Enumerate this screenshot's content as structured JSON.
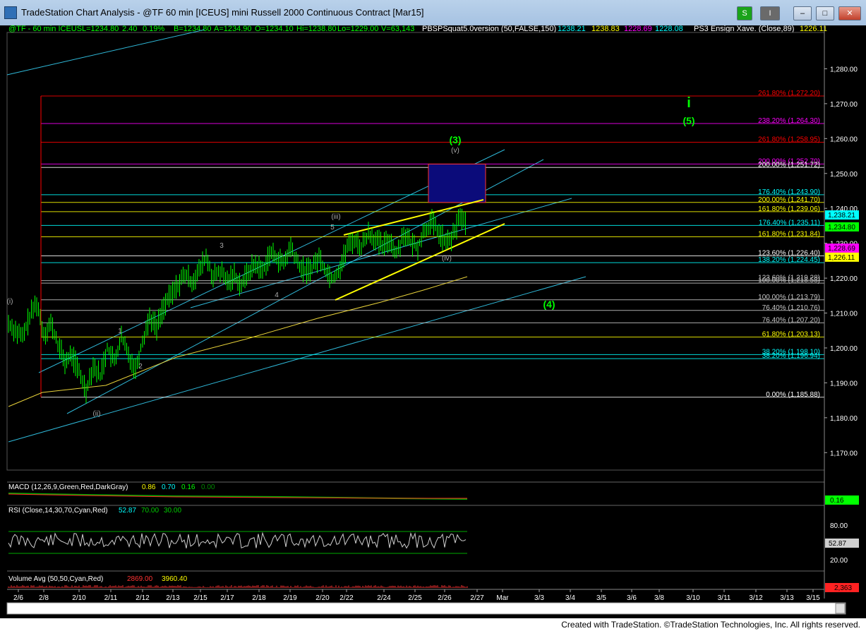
{
  "window": {
    "title": "TradeStation Chart Analysis - @TF 60 min [ICEUS] mini Russell 2000 Continuous Contract [Mar15]",
    "btn_s": "S",
    "btn_i": "I"
  },
  "header": {
    "symbol": "@TF - 60 min  ICEUS",
    "last": "L=1234.80",
    "change": "2.40",
    "pct": "0.19%",
    "bid": "B=1234.80",
    "ask": "A=1234.90",
    "open": "O=1234.10",
    "high": "Hi=1238.80",
    "low": "Lo=1229.00",
    "vol": "V=63,143",
    "indicator": "PBSPSquat5.0version (50,FALSE,150)",
    "ind_v1": "1238.21",
    "ind_v2": "1238.83",
    "ind_v3": "1228.69",
    "ind_v4": "1228.08",
    "ps3": "PS3 Ensign Xave. (Close,89)",
    "ps3_val": "1226.11"
  },
  "colors": {
    "price": "#00ff00",
    "cyan": "#00ffff",
    "yellow": "#ffff00",
    "red": "#ff0000",
    "magenta": "#ff00ff",
    "blue_box": "#0b0b7a",
    "fib_gray": "#c8c8c8"
  },
  "chart_data": [
    {
      "type": "line",
      "panel": "price",
      "y_axis": {
        "ylim": [
          1165,
          1290
        ],
        "ticks": [
          1170,
          1180,
          1190,
          1200,
          1210,
          1220,
          1230,
          1240,
          1250,
          1260,
          1270,
          1280
        ],
        "tick_labels": [
          "1,170.00",
          "1,180.00",
          "1,190.00",
          "1,200.00",
          "1,210.00",
          "1,220.00",
          "1,230.00",
          "1,240.00",
          "1,250.00",
          "1,260.00",
          "1,270.00",
          "1,280.00"
        ]
      },
      "x_axis": {
        "tick_labels": [
          "2/6",
          "2/8",
          "2/10",
          "2/11",
          "2/12",
          "2/13",
          "2/15",
          "2/17",
          "2/18",
          "2/19",
          "2/20",
          "2/22",
          "2/24",
          "2/25",
          "2/26",
          "2/27",
          "Mar",
          "3/3",
          "3/4",
          "3/5",
          "3/6",
          "3/8",
          "3/10",
          "3/11",
          "3/12",
          "3/13",
          "3/15"
        ]
      },
      "price_points": [
        [
          0,
          1207
        ],
        [
          4,
          1205
        ],
        [
          8,
          1203
        ],
        [
          12,
          1209
        ],
        [
          16,
          1213
        ],
        [
          20,
          1204
        ],
        [
          24,
          1207
        ],
        [
          28,
          1201
        ],
        [
          32,
          1196
        ],
        [
          36,
          1198
        ],
        [
          40,
          1193
        ],
        [
          44,
          1188
        ],
        [
          48,
          1195
        ],
        [
          52,
          1192
        ],
        [
          56,
          1200
        ],
        [
          60,
          1196
        ],
        [
          64,
          1203
        ],
        [
          68,
          1198
        ],
        [
          72,
          1194
        ],
        [
          76,
          1202
        ],
        [
          80,
          1209
        ],
        [
          84,
          1206
        ],
        [
          88,
          1212
        ],
        [
          92,
          1215
        ],
        [
          96,
          1218
        ],
        [
          100,
          1221
        ],
        [
          104,
          1219
        ],
        [
          108,
          1222
        ],
        [
          112,
          1226
        ],
        [
          116,
          1220
        ],
        [
          120,
          1222
        ],
        [
          124,
          1219
        ],
        [
          128,
          1221
        ],
        [
          132,
          1218
        ],
        [
          136,
          1222
        ],
        [
          140,
          1224
        ],
        [
          144,
          1222
        ],
        [
          148,
          1227
        ],
        [
          152,
          1226
        ],
        [
          156,
          1224
        ],
        [
          160,
          1229
        ],
        [
          164,
          1224
        ],
        [
          168,
          1222
        ],
        [
          172,
          1223
        ],
        [
          176,
          1226
        ],
        [
          180,
          1222
        ],
        [
          184,
          1220
        ],
        [
          188,
          1223
        ],
        [
          192,
          1229
        ],
        [
          196,
          1231
        ],
        [
          200,
          1229
        ],
        [
          204,
          1233
        ],
        [
          208,
          1231
        ],
        [
          212,
          1229
        ],
        [
          216,
          1231
        ],
        [
          220,
          1227
        ],
        [
          224,
          1233
        ],
        [
          228,
          1230
        ],
        [
          232,
          1229
        ],
        [
          236,
          1234
        ],
        [
          240,
          1236
        ],
        [
          244,
          1233
        ],
        [
          248,
          1230
        ],
        [
          252,
          1232
        ],
        [
          256,
          1238
        ],
        [
          260,
          1234.8
        ]
      ],
      "levels": [
        {
          "label": "261.80% (1,272.20)",
          "value": 1272.2,
          "color": "#ff0000"
        },
        {
          "label": "238.20% (1,264.30)",
          "value": 1264.3,
          "color": "#ff00ff"
        },
        {
          "label": "261.80% (1,258.95)",
          "value": 1258.95,
          "color": "#ff0000"
        },
        {
          "label": "200.00% (1,252.70)",
          "value": 1252.7,
          "color": "#ff00ff"
        },
        {
          "label": "200.00% (1,251.72)",
          "value": 1251.72,
          "color": "#ffffff"
        },
        {
          "label": "176.40% (1,243.90)",
          "value": 1243.9,
          "color": "#00ffff"
        },
        {
          "label": "200.00% (1,241.70)",
          "value": 1241.7,
          "color": "#ffff00"
        },
        {
          "label": "161.80% (1,239.06)",
          "value": 1239.06,
          "color": "#ffff00"
        },
        {
          "label": "176.40% (1,235.11)",
          "value": 1235.11,
          "color": "#00ffff"
        },
        {
          "label": "161.80% (1,231.84)",
          "value": 1231.84,
          "color": "#ffff00"
        },
        {
          "label": "123.60% (1,226.40)",
          "value": 1226.4,
          "color": "#ffffff"
        },
        {
          "label": "138.20% (1,224.45)",
          "value": 1224.45,
          "color": "#00ffff"
        },
        {
          "label": "123.60% (1,219.28)",
          "value": 1219.28,
          "color": "#c8c8c8"
        },
        {
          "label": "100.00% (1,218.58)",
          "value": 1218.58,
          "color": "#c8c8c8"
        },
        {
          "label": "100.00% (1,213.79)",
          "value": 1213.79,
          "color": "#c8c8c8"
        },
        {
          "label": "76.40% (1,210.76)",
          "value": 1210.76,
          "color": "#c8c8c8"
        },
        {
          "label": "76.40% (1,207.20)",
          "value": 1207.2,
          "color": "#c8c8c8"
        },
        {
          "label": "61.80% (1,203.13)",
          "value": 1203.13,
          "color": "#ffff00"
        },
        {
          "label": "38.20% (1,198.10)",
          "value": 1198.1,
          "color": "#00ffff"
        },
        {
          "label": "38.20% (1,196.94)",
          "value": 1196.94,
          "color": "#00ffff"
        },
        {
          "label": "0.00% (1,185.88)",
          "value": 1185.88,
          "color": "#ffffff"
        }
      ],
      "axis_badges": [
        {
          "label": "1,238.21",
          "value": 1238.21,
          "bg": "#00ffff",
          "fg": "#000000"
        },
        {
          "label": "1,234.80",
          "value": 1234.8,
          "bg": "#00ff00",
          "fg": "#000000"
        },
        {
          "label": "1,228.69",
          "value": 1228.69,
          "bg": "#ff00ff",
          "fg": "#000000"
        },
        {
          "label": "1,226.11",
          "value": 1226.11,
          "bg": "#ffff00",
          "fg": "#000000"
        }
      ],
      "wave_labels": [
        {
          "text": "(i)",
          "color": "#aaaaaa"
        },
        {
          "text": "(ii)",
          "color": "#aaaaaa"
        },
        {
          "text": "1",
          "color": "#aaaaaa"
        },
        {
          "text": "2",
          "color": "#aaaaaa"
        },
        {
          "text": "3",
          "color": "#aaaaaa"
        },
        {
          "text": "4",
          "color": "#aaaaaa"
        },
        {
          "text": "5",
          "color": "#aaaaaa"
        },
        {
          "text": "(iii)",
          "color": "#aaaaaa"
        },
        {
          "text": "(iv)",
          "color": "#aaaaaa"
        },
        {
          "text": "(v)",
          "color": "#aaaaaa"
        },
        {
          "text": "(3)",
          "color": "#00ff00"
        },
        {
          "text": "(4)",
          "color": "#00ff00"
        },
        {
          "text": "(5)",
          "color": "#00ff00"
        },
        {
          "text": "i",
          "color": "#00ff00"
        }
      ]
    },
    {
      "type": "bar",
      "panel": "macd",
      "title": "MACD (12,26,9,Green,Red,DarkGray)",
      "values_text": [
        "0.86",
        "0.70",
        "0.16",
        "0.00"
      ],
      "axis_badge": "0.16"
    },
    {
      "type": "line",
      "panel": "rsi",
      "title": "RSI (Close,14,30,70,Cyan,Red)",
      "values_text": [
        "52.87",
        "70.00",
        "30.00"
      ],
      "tick_labels": [
        "80.00",
        "20.00"
      ],
      "axis_badge": "52.87"
    },
    {
      "type": "bar",
      "panel": "volume",
      "title": "Volume Avg (50,50,Cyan,Red)",
      "values_text": [
        "2869.00",
        "3960.40"
      ],
      "axis_badge": "2,363"
    }
  ],
  "footer": {
    "text": "Created with TradeStation. ©TradeStation Technologies, Inc. All rights reserved."
  }
}
